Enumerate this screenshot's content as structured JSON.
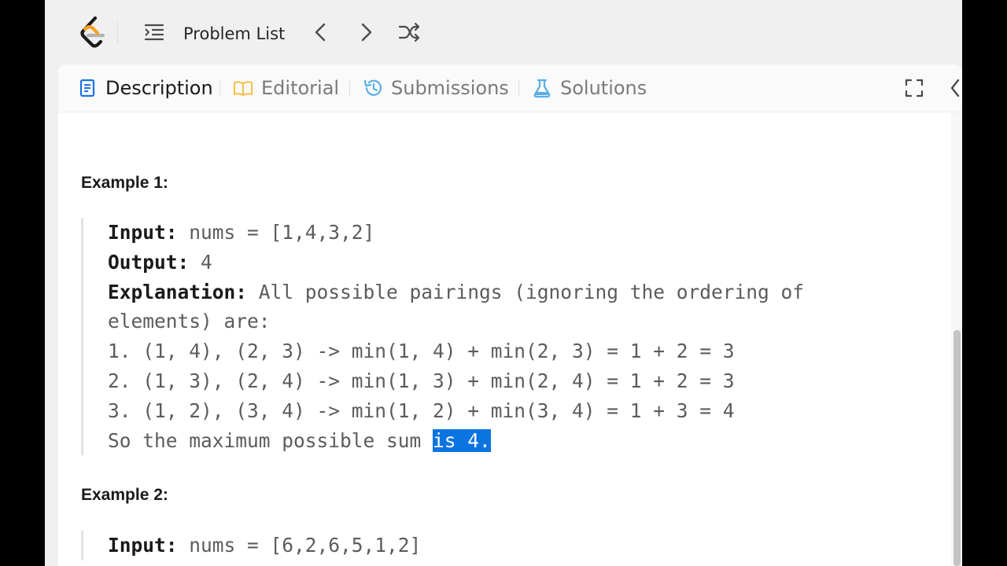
{
  "topbar": {
    "problem_list_label": "Problem List"
  },
  "tabs": [
    {
      "label": "Description",
      "icon": "document-icon",
      "active": true
    },
    {
      "label": "Editorial",
      "icon": "book-icon",
      "active": false
    },
    {
      "label": "Submissions",
      "icon": "history-icon",
      "active": false
    },
    {
      "label": "Solutions",
      "icon": "flask-icon",
      "active": false
    }
  ],
  "examples": [
    {
      "heading": "Example 1:",
      "input_label": "Input:",
      "input_value": "nums = [1,4,3,2]",
      "output_label": "Output:",
      "output_value": "4",
      "explanation_label": "Explanation:",
      "explanation_first": "All possible pairings (ignoring the ordering of",
      "explanation_lines": [
        "elements) are:",
        "1. (1, 4), (2, 3) -> min(1, 4) + min(2, 3) = 1 + 2 = 3",
        "2. (1, 3), (2, 4) -> min(1, 3) + min(2, 4) = 1 + 2 = 3",
        "3. (1, 2), (3, 4) -> min(1, 2) + min(3, 4) = 1 + 3 = 4"
      ],
      "final_line_plain": "So the maximum possible sum ",
      "final_line_selected": "is 4."
    },
    {
      "heading": "Example 2:",
      "input_label": "Input:",
      "input_value": "nums = [6,2,6,5,1,2]"
    }
  ],
  "colors": {
    "selection": "#0a74e0",
    "logo_orange": "#f89f1b",
    "logo_gray": "#b3b3b3",
    "editorial_icon": "#f5c046",
    "submissions_icon": "#5aaee8",
    "solutions_icon": "#5aaee8",
    "description_icon": "#1a73e8"
  }
}
